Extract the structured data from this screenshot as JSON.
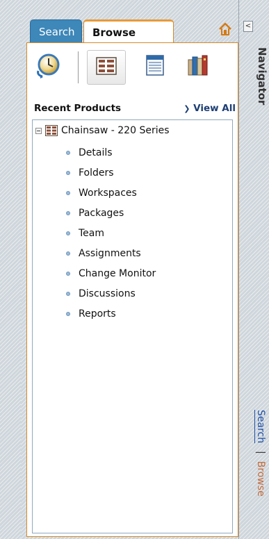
{
  "tabs": {
    "search_label": "Search",
    "browse_label": "Browse",
    "active": "Browse"
  },
  "toolbar": {
    "views": [
      "recent-view-icon",
      "tree-view-icon",
      "list-view-icon",
      "shelf-view-icon"
    ],
    "selected_view": "tree-view-icon"
  },
  "recent_products": {
    "title": "Recent Products",
    "view_all_label": "View All"
  },
  "tree": {
    "root_label": "Chainsaw - 220 Series",
    "items": [
      {
        "label": "Details"
      },
      {
        "label": "Folders"
      },
      {
        "label": "Workspaces"
      },
      {
        "label": "Packages"
      },
      {
        "label": "Team"
      },
      {
        "label": "Assignments"
      },
      {
        "label": "Change Monitor"
      },
      {
        "label": "Discussions"
      },
      {
        "label": "Reports"
      }
    ]
  },
  "navigator": {
    "title": "Navigator",
    "collapse_label": "<",
    "link_search": "Search",
    "link_separator": "|",
    "link_browse": "Browse"
  },
  "colors": {
    "search_tab": "#3d87b9",
    "browse_tab_accent": "#e89a38",
    "bullet": "#9bbad7",
    "link_blue": "#1f4fa5",
    "link_browse": "#c26c3e"
  }
}
